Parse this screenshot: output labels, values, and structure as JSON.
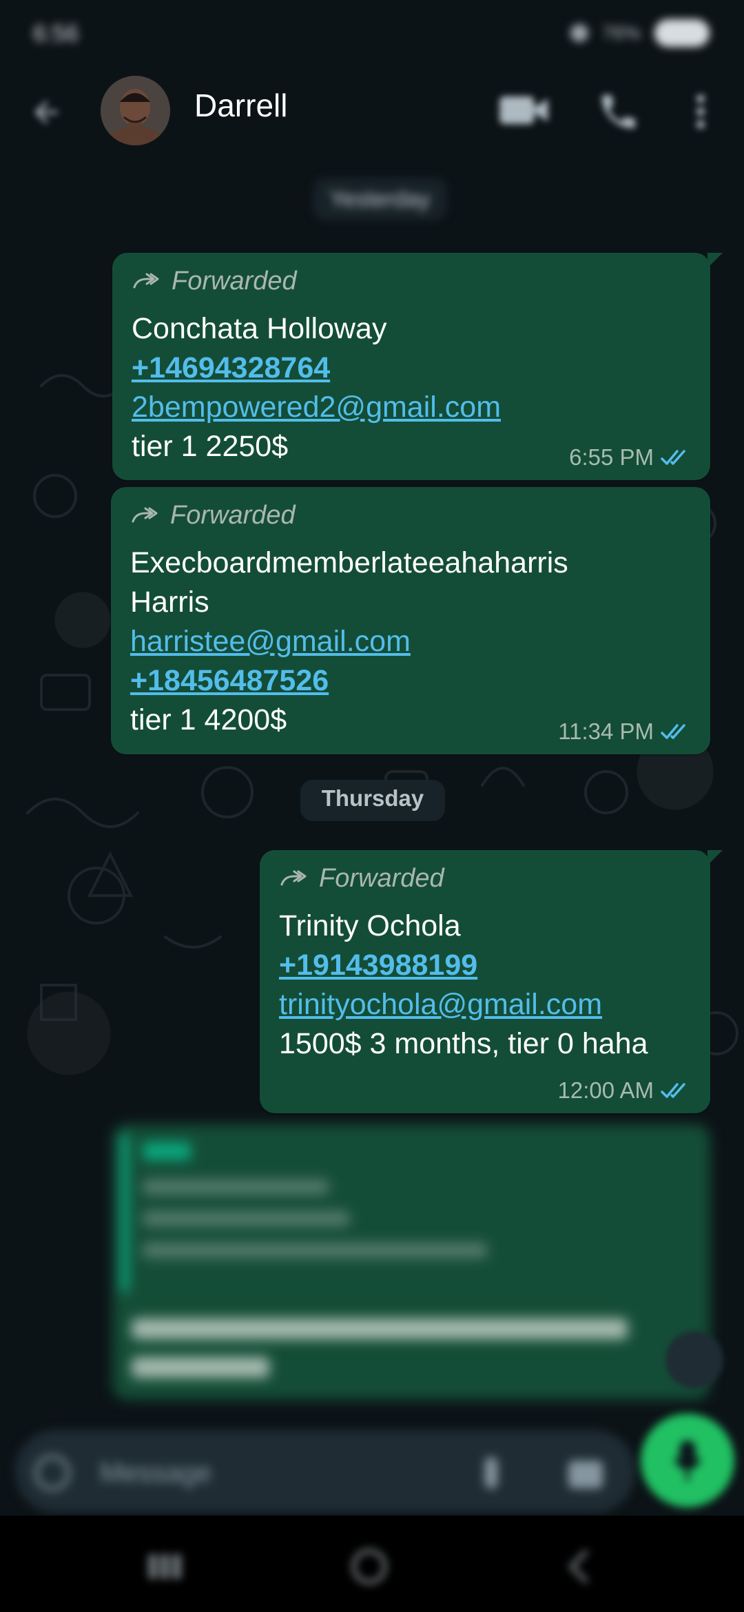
{
  "status_bar": {
    "time": "6:56",
    "right_text": "76%"
  },
  "header": {
    "contact_name": "Darrell",
    "back_icon": "back-arrow-icon",
    "video_icon": "video-call-icon",
    "call_icon": "phone-icon",
    "menu_icon": "more-vert-icon"
  },
  "date_chips": {
    "top": "Yesterday",
    "middle": "Thursday"
  },
  "messages": [
    {
      "forwarded_label": "Forwarded",
      "name": "Conchata Holloway",
      "phone": "+14694328764",
      "email": "2bempowered2@gmail.com",
      "note": "tier 1 2250$",
      "time": "6:55 PM",
      "status": "read"
    },
    {
      "forwarded_label": "Forwarded",
      "name_line1": "Execboardmemberlateeahaharris",
      "name_line2": "Harris",
      "email": "harristee@gmail.com",
      "phone": "+18456487526",
      "note": "tier 1 4200$",
      "time": "11:34 PM",
      "status": "read"
    },
    {
      "forwarded_label": "Forwarded",
      "name": "Trinity Ochola",
      "phone": "+19143988199",
      "email": "trinityochola@gmail.com",
      "note": "1500$ 3 months, tier 0 haha",
      "time": "12:00 AM",
      "status": "read"
    }
  ],
  "composer": {
    "placeholder": "Message"
  },
  "colors": {
    "bubble": "#144d37",
    "link": "#53bdeb",
    "background": "#0b141a",
    "accent": "#21c063",
    "read_ticks": "#53bdeb"
  }
}
